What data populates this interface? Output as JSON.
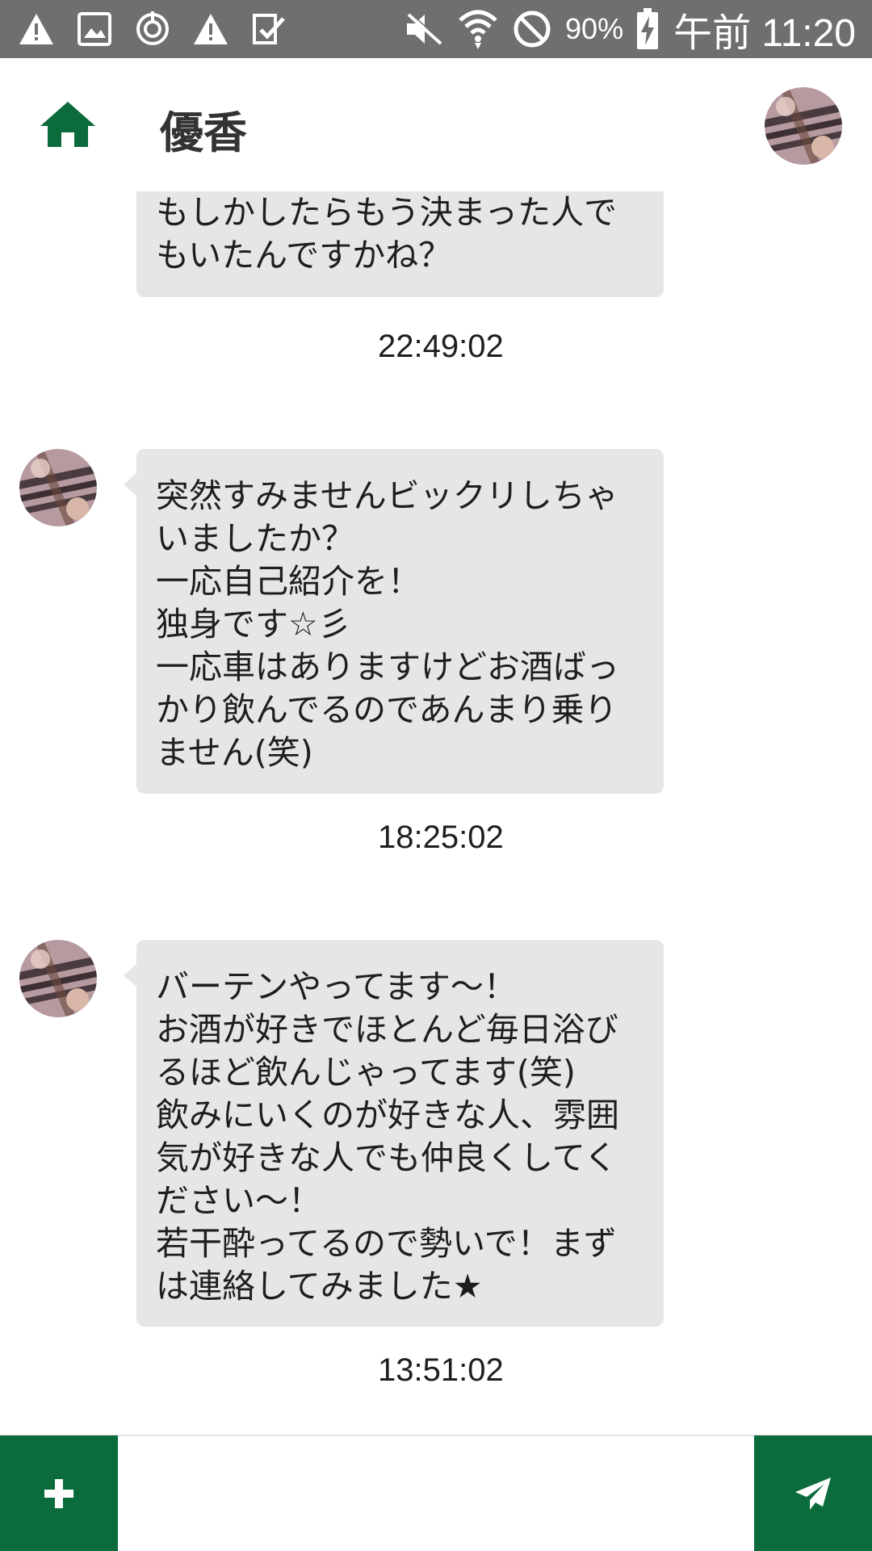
{
  "status_bar": {
    "icons_left": [
      "warning-icon",
      "image-icon",
      "sync-icon",
      "warning-icon",
      "checklist-icon"
    ],
    "icons_right": [
      "muted-speaker-icon",
      "wifi-icon",
      "no-sim-icon",
      "battery-charging-icon"
    ],
    "battery": "90%",
    "time": "午前 11:20"
  },
  "header": {
    "title": "優香",
    "home_icon": "home-icon",
    "avatar_icon": "avatar"
  },
  "messages": [
    {
      "text": "もしかしたらもう決まった人でもいたんですかね？",
      "time": "22:49:02"
    },
    {
      "text": "突然すみませんビックリしちゃいましたか？\n一応自己紹介を！\n独身です☆彡\n一応車はありますけどお酒ばっかり飲んでるのであんまり乗りません(笑)",
      "time": "18:25:02"
    },
    {
      "text": "バーテンやってます～！\nお酒が好きでほとんど毎日浴びるほど飲んじゃってます(笑)\n飲みにいくのが好きな人、雰囲気が好きな人でも仲良くしてください～！\n若干酔ってるので勢いで！まずは連絡してみました★",
      "time": "13:51:02"
    }
  ],
  "input_bar": {
    "placeholder": "",
    "value": "",
    "plus_icon": "plus-icon",
    "send_icon": "send-icon"
  },
  "colors": {
    "accent": "#0b6b3a",
    "status_bar": "#6f6f6f",
    "bubble": "#e6e6e6"
  }
}
